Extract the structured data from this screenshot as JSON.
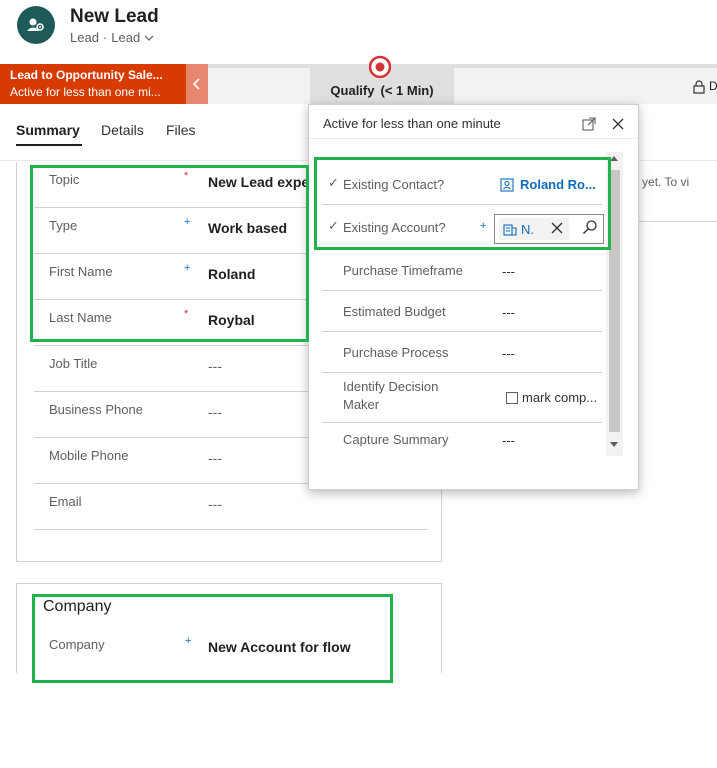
{
  "colors": {
    "accent_stage": "#d83b01",
    "link": "#0f6cbd",
    "required_red": "#d13438",
    "required_blue": "#0f6cbd",
    "highlight": "#22b24c",
    "avatar_bg": "#1f5a5a"
  },
  "header": {
    "title": "New Lead",
    "entity": "Lead",
    "separator": "·",
    "form_selector": "Lead"
  },
  "bpf": {
    "active_stage_name": "Lead to Opportunity Sale...",
    "active_stage_status": "Active for less than one mi...",
    "current_stage_label": "Qualify",
    "current_stage_duration": "(< 1 Min)",
    "right_cut_text": "D"
  },
  "tabs": [
    {
      "label": "Summary",
      "active": true
    },
    {
      "label": "Details",
      "active": false
    },
    {
      "label": "Files",
      "active": false
    }
  ],
  "form": {
    "fields": [
      {
        "label": "Topic",
        "required": "*",
        "required_type": "red",
        "value": "New Lead experie"
      },
      {
        "label": "Type",
        "required": "+",
        "required_type": "blue",
        "value": "Work based"
      },
      {
        "label": "First Name",
        "required": "+",
        "required_type": "blue",
        "value": "Roland"
      },
      {
        "label": "Last Name",
        "required": "*",
        "required_type": "red",
        "value": "Roybal"
      },
      {
        "label": "Job Title",
        "required": "",
        "value": "---"
      },
      {
        "label": "Business Phone",
        "required": "",
        "value": "---"
      },
      {
        "label": "Mobile Phone",
        "required": "",
        "value": "---"
      },
      {
        "label": "Email",
        "required": "",
        "value": "---"
      }
    ],
    "company_section": {
      "title": "Company",
      "label": "Company",
      "required": "+",
      "value": "New Account for flow"
    }
  },
  "right_panel": {
    "text": "ted yet.  To vi"
  },
  "flyout": {
    "header": "Active for less than one minute",
    "existing_contact": {
      "label": "Existing Contact?",
      "value": "Roland Ro..."
    },
    "existing_account": {
      "label": "Existing Account?",
      "required": "+",
      "chip_value": "N."
    },
    "rows": [
      {
        "label": "Purchase Timeframe",
        "value": "---"
      },
      {
        "label": "Estimated Budget",
        "value": "---"
      },
      {
        "label": "Purchase Process",
        "value": "---"
      },
      {
        "label_line1": "Identify Decision",
        "label_line2": "Maker",
        "checkbox_label": "mark comp..."
      },
      {
        "label": "Capture Summary",
        "value": "---"
      }
    ],
    "check_glyph": "✓"
  }
}
